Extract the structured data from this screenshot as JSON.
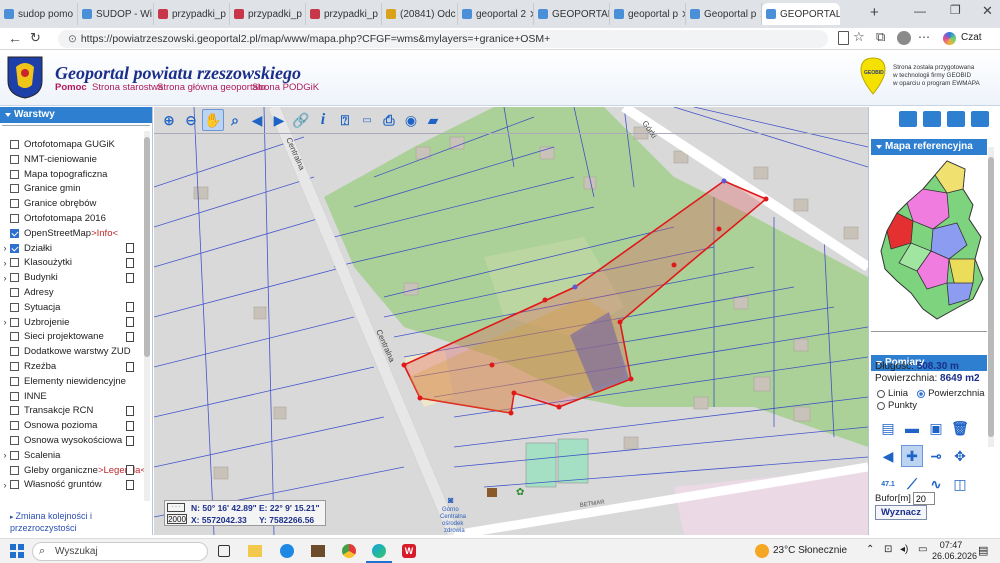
{
  "browser": {
    "tabs": [
      {
        "label": "sudop pomo",
        "color": "#4a8fd8"
      },
      {
        "label": "SUDOP - Wi",
        "color": "#4a8fd8"
      },
      {
        "label": "przypadki_p",
        "color": "#c8364a"
      },
      {
        "label": "przypadki_p",
        "color": "#c8364a"
      },
      {
        "label": "przypadki_p",
        "color": "#c8364a"
      },
      {
        "label": "(20841) Odc",
        "color": "#d9a21a"
      },
      {
        "label": "geoportal 2",
        "color": "#4a8fd8"
      },
      {
        "label": "GEOPORTAL",
        "color": "#4a8fd8"
      },
      {
        "label": "geoportal p",
        "color": "#4a8fd8"
      },
      {
        "label": "Geoportal p",
        "color": "#4a8fd8"
      },
      {
        "label": "GEOPORTAL",
        "color": "#4a8fd8"
      }
    ],
    "url": "https://powiatrzeszowski.geoportal2.pl/map/www/mapa.php?CFGF=wms&mylayers=+granice+OSM+",
    "copilot": "Czat"
  },
  "header": {
    "title": "Geoportal powiatu rzeszowskiego",
    "links": [
      "Pomoc",
      "Strona starostwa",
      "Strona główna geoportalu",
      "Strona PODGiK"
    ],
    "geobid_logo": "GEOBID",
    "geobid_text": [
      "Strona została przygotowana",
      "w technologii firmy GEOBID",
      "w oparciu o program EWMAPA"
    ]
  },
  "sidebar": {
    "title": "Warstwy",
    "layers": [
      {
        "label": "Ortofotomapa GUGiK",
        "checked": false,
        "expand": false,
        "doc": false
      },
      {
        "label": "NMT-cieniowanie",
        "checked": false,
        "expand": false,
        "doc": false
      },
      {
        "label": "Mapa topograficzna",
        "checked": false,
        "expand": false,
        "doc": false
      },
      {
        "label": "Granice gmin",
        "checked": false,
        "expand": false,
        "doc": false
      },
      {
        "label": "Granice obrębów",
        "checked": false,
        "expand": false,
        "doc": false
      },
      {
        "label": "Ortofotomapa 2016",
        "checked": false,
        "expand": false,
        "doc": false
      },
      {
        "label": "OpenStreetMap",
        "extra": ">Info<",
        "checked": true,
        "expand": false,
        "doc": false
      },
      {
        "label": "Działki",
        "checked": true,
        "expand": true,
        "doc": true
      },
      {
        "label": "Klasoużytki",
        "checked": false,
        "expand": true,
        "doc": true
      },
      {
        "label": "Budynki",
        "checked": false,
        "expand": true,
        "doc": true
      },
      {
        "label": "Adresy",
        "checked": false,
        "expand": false,
        "doc": false
      },
      {
        "label": "Sytuacja",
        "checked": false,
        "expand": false,
        "doc": true
      },
      {
        "label": "Uzbrojenie",
        "checked": false,
        "expand": true,
        "doc": true
      },
      {
        "label": "Sieci projektowane",
        "checked": false,
        "expand": false,
        "doc": true
      },
      {
        "label": "Dodatkowe warstwy ZUD",
        "checked": false,
        "expand": false,
        "doc": false
      },
      {
        "label": "Rzeźba",
        "checked": false,
        "expand": false,
        "doc": true
      },
      {
        "label": "Elementy niewidencyjne",
        "checked": false,
        "expand": false,
        "doc": false
      },
      {
        "label": "INNE",
        "checked": false,
        "expand": false,
        "doc": false
      },
      {
        "label": "Transakcje RCN",
        "checked": false,
        "expand": false,
        "doc": true
      },
      {
        "label": "Osnowa pozioma",
        "checked": false,
        "expand": false,
        "doc": true
      },
      {
        "label": "Osnowa wysokościowa",
        "checked": false,
        "expand": false,
        "doc": true
      },
      {
        "label": "Scalenia",
        "checked": false,
        "expand": true,
        "doc": false
      },
      {
        "label": "Gleby organiczne",
        "extra": ">Legenda<",
        "checked": false,
        "expand": false,
        "doc": true
      },
      {
        "label": "Własność gruntów",
        "checked": false,
        "expand": true,
        "doc": true
      }
    ],
    "bottom_link": "Zmiana kolejności i przezroczystości"
  },
  "map": {
    "streets": [
      "Centralna",
      "Centralna",
      "Górki",
      "BETMAR"
    ],
    "poi": [
      "Górno",
      "Centralna",
      "ośrodek",
      "zdrowia"
    ]
  },
  "coords": {
    "scale": "2000",
    "n_label": "N:",
    "n_value": "50° 16' 42.89\"",
    "e_label": "E:",
    "e_value": "22° 9' 15.21\"",
    "x_label": "X:",
    "x_value": "5572042.33",
    "y_label": "Y:",
    "y_value": "7582266.56"
  },
  "right": {
    "ref_title": "Mapa referencyjna",
    "meas_title": "Pomiary",
    "len_label": "Długość:",
    "len_value": "508.30 m",
    "area_label": "Powierzchnia:",
    "area_value": "8649 m2",
    "modes": [
      "Linia",
      "Powierzchnia",
      "Punkty"
    ],
    "selected_mode": "Powierzchnia",
    "buffer_label": "Bufor[m]",
    "buffer_value": "20",
    "compute_label": "Wyznacz",
    "area_badge": "47.1"
  },
  "taskbar": {
    "search_placeholder": "Wyszukaj",
    "weather": "23°C  Słonecznie",
    "time": "07:47",
    "date": "26.06.2026"
  }
}
